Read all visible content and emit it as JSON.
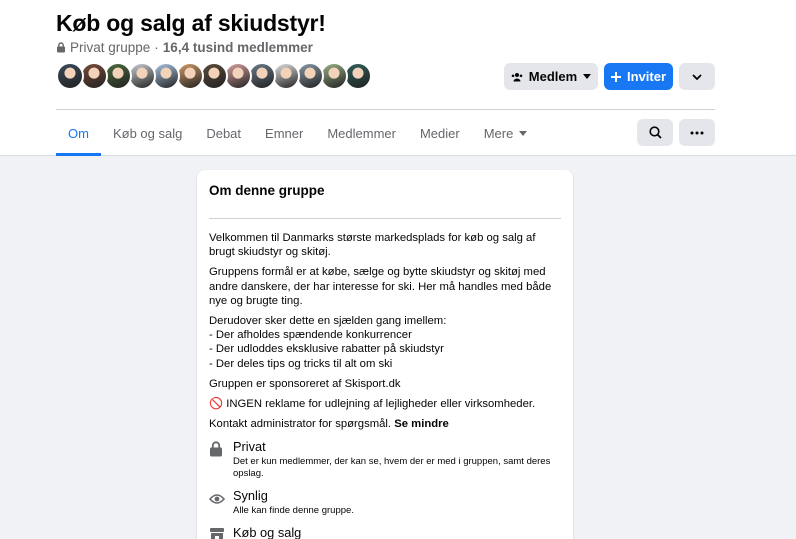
{
  "group": {
    "title": "Køb og salg af skiudstyr!",
    "privacy": "Privat gruppe",
    "separator": "·",
    "members": "16,4 tusind medlemmer"
  },
  "avatars": [
    {
      "color": "#3b4a5a"
    },
    {
      "color": "#7a4b3a"
    },
    {
      "color": "#4a6b3c"
    },
    {
      "color": "#c9ccd1"
    },
    {
      "color": "#a8c4e0"
    },
    {
      "color": "#d19a6a"
    },
    {
      "color": "#5a4a3a"
    },
    {
      "color": "#d8a0a0"
    },
    {
      "color": "#6c7a8a"
    },
    {
      "color": "#e0e0e0"
    },
    {
      "color": "#8a9aa8"
    },
    {
      "color": "#9ab088"
    },
    {
      "color": "#2f5f5a"
    }
  ],
  "actions": {
    "member_label": "Medlem",
    "invite_label": "Inviter"
  },
  "tabs": [
    {
      "label": "Om",
      "active": true
    },
    {
      "label": "Køb og salg"
    },
    {
      "label": "Debat"
    },
    {
      "label": "Emner"
    },
    {
      "label": "Medlemmer"
    },
    {
      "label": "Medier"
    },
    {
      "label": "Mere"
    }
  ],
  "about": {
    "title": "Om denne gruppe",
    "paragraphs": [
      "Velkommen til Danmarks største markedsplads for køb og salg af brugt skiudstyr og skitøj.",
      "Gruppens formål er at købe, sælge og bytte skiudstyr og skitøj med andre danskere, der har interesse for ski. Her må handles med både nye og brugte ting.",
      "Derudover sker dette en sjælden gang imellem:",
      "- Der afholdes spændende konkurrencer",
      "- Der udloddes eksklusive rabatter på skiudstyr",
      "- Der deles tips og tricks til alt om ski",
      "Gruppen er sponsoreret af Skisport.dk",
      "🚫 INGEN reklame for udlejning af lejligheder eller virksomheder.",
      "Kontakt administrator for spørgsmål."
    ],
    "see_less": "Se mindre",
    "properties": [
      {
        "icon": "lock-icon",
        "title": "Privat",
        "desc": "Det er kun medlemmer, der kan se, hvem der er med i gruppen, samt deres opslag."
      },
      {
        "icon": "eye-icon",
        "title": "Synlig",
        "desc": "Alle kan finde denne gruppe."
      },
      {
        "icon": "shop-icon",
        "title": "Køb og salg",
        "desc": ""
      }
    ]
  },
  "colors": {
    "accent": "#1877f2",
    "background": "#f0f2f5",
    "secondary_text": "#65676b"
  }
}
